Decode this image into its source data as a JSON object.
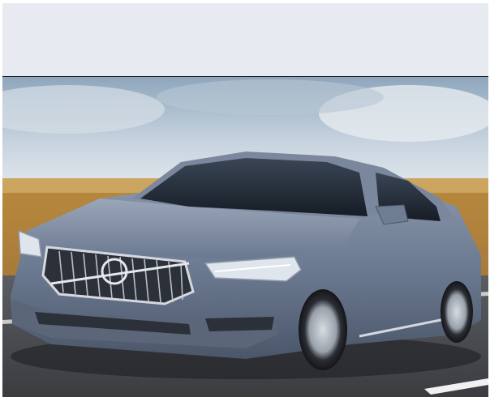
{
  "page": {
    "header_banner": {
      "color": "#e8eaf1"
    },
    "hero_photo": {
      "subject": "car-photo",
      "colors": {
        "sky_top": "#a9bccd",
        "sky_bottom": "#dfe6ec",
        "field": "#c79a48",
        "road": "#4a4d52",
        "car_body": "#6f7d93",
        "car_shadow": "#3f4859",
        "glass": "#1e2530",
        "chrome": "#c9ced6"
      }
    }
  }
}
